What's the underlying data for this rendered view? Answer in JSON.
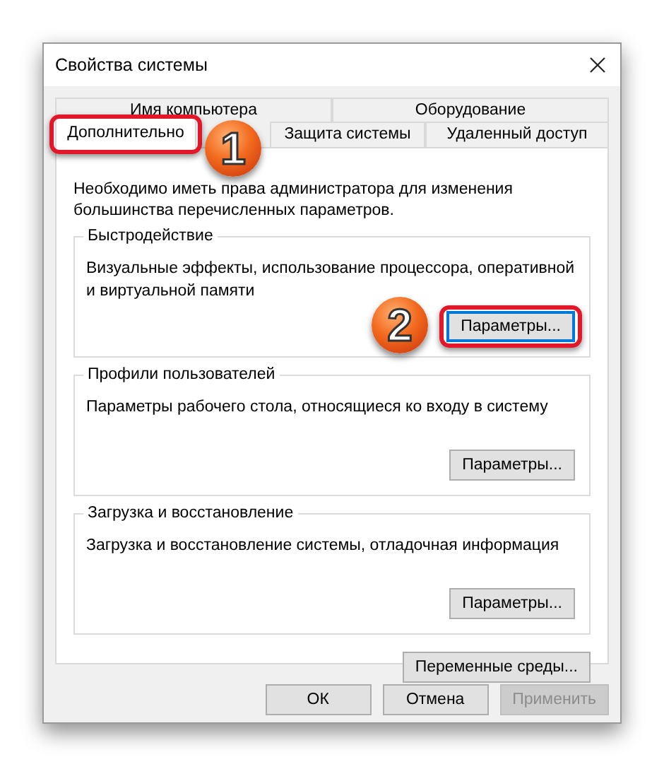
{
  "window": {
    "title": "Свойства системы"
  },
  "tab_rows": [
    [
      {
        "label": "Имя компьютера",
        "selected": false,
        "highlighted": false
      },
      {
        "label": "Оборудование",
        "selected": false,
        "highlighted": false
      }
    ],
    [
      {
        "label": "Дополнительно",
        "selected": true,
        "highlighted": true
      },
      {
        "label": "Защита системы",
        "selected": false,
        "highlighted": false
      },
      {
        "label": "Удаленный доступ",
        "selected": false,
        "highlighted": false
      }
    ]
  ],
  "intro": "Необходимо иметь права администратора для изменения большинства перечисленных параметров.",
  "groups": [
    {
      "title": "Быстродействие",
      "description": "Визуальные эффекты, использование процессора, оперативной и виртуальной памяти",
      "button": {
        "label": "Параметры...",
        "focused": true,
        "highlighted": true
      }
    },
    {
      "title": "Профили пользователей",
      "description": "Параметры рабочего стола, относящиеся ко входу в систему",
      "button": {
        "label": "Параметры...",
        "focused": false,
        "highlighted": false
      }
    },
    {
      "title": "Загрузка и восстановление",
      "description": "Загрузка и восстановление системы, отладочная информация",
      "button": {
        "label": "Параметры...",
        "focused": false,
        "highlighted": false
      }
    }
  ],
  "env_button": "Переменные среды...",
  "footer_buttons": [
    {
      "label": "ОК",
      "disabled": false
    },
    {
      "label": "Отмена",
      "disabled": false
    },
    {
      "label": "Применить",
      "disabled": true
    }
  ],
  "callouts": [
    {
      "number": "1"
    },
    {
      "number": "2"
    }
  ]
}
